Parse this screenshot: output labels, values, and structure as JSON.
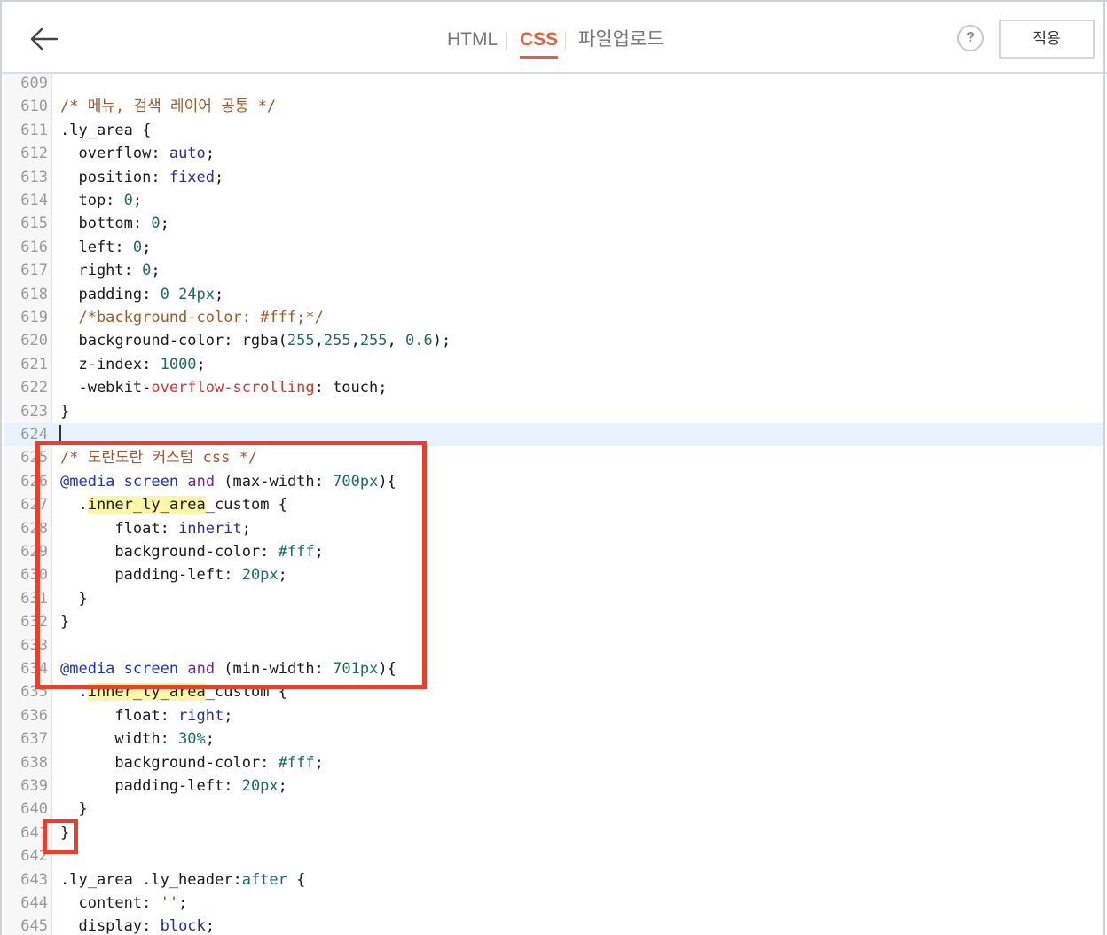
{
  "toolbar": {
    "tabs": [
      {
        "label": "HTML",
        "active": false
      },
      {
        "label": "CSS",
        "active": true
      },
      {
        "label": "파일업로드",
        "active": false
      }
    ],
    "help_label": "?",
    "apply_label": "적용"
  },
  "accent_color": "#ef5a33",
  "annotation_color": "#e8402a",
  "editor": {
    "current_line": 624,
    "lines": [
      {
        "n": "609",
        "tokens": []
      },
      {
        "n": "610",
        "tokens": [
          [
            "cm",
            "/* 메뉴, 검색 레이어 공통 */"
          ]
        ]
      },
      {
        "n": "611",
        "tokens": [
          [
            "pr",
            ".ly_area {"
          ]
        ]
      },
      {
        "n": "612",
        "tokens": [
          [
            "pr",
            "  overflow: "
          ],
          [
            "val",
            "auto"
          ],
          [
            "pr",
            ";"
          ]
        ]
      },
      {
        "n": "613",
        "tokens": [
          [
            "pr",
            "  position: "
          ],
          [
            "val",
            "fixed"
          ],
          [
            "pr",
            ";"
          ]
        ]
      },
      {
        "n": "614",
        "tokens": [
          [
            "pr",
            "  top: "
          ],
          [
            "nm",
            "0"
          ],
          [
            "pr",
            ";"
          ]
        ]
      },
      {
        "n": "615",
        "tokens": [
          [
            "pr",
            "  bottom: "
          ],
          [
            "nm",
            "0"
          ],
          [
            "pr",
            ";"
          ]
        ]
      },
      {
        "n": "616",
        "tokens": [
          [
            "pr",
            "  left: "
          ],
          [
            "nm",
            "0"
          ],
          [
            "pr",
            ";"
          ]
        ]
      },
      {
        "n": "617",
        "tokens": [
          [
            "pr",
            "  right: "
          ],
          [
            "nm",
            "0"
          ],
          [
            "pr",
            ";"
          ]
        ]
      },
      {
        "n": "618",
        "tokens": [
          [
            "pr",
            "  padding: "
          ],
          [
            "nm",
            "0 24px"
          ],
          [
            "pr",
            ";"
          ]
        ]
      },
      {
        "n": "619",
        "tokens": [
          [
            "cm",
            "  /*background-color: #fff;*/"
          ]
        ]
      },
      {
        "n": "620",
        "tokens": [
          [
            "pr",
            "  background-color: rgba("
          ],
          [
            "nm",
            "255"
          ],
          [
            "pr",
            ","
          ],
          [
            "nm",
            "255"
          ],
          [
            "pr",
            ","
          ],
          [
            "nm",
            "255"
          ],
          [
            "pr",
            ", "
          ],
          [
            "nm",
            "0.6"
          ],
          [
            "pr",
            ");"
          ]
        ]
      },
      {
        "n": "621",
        "tokens": [
          [
            "pr",
            "  z-index: "
          ],
          [
            "nm",
            "1000"
          ],
          [
            "pr",
            ";"
          ]
        ]
      },
      {
        "n": "622",
        "tokens": [
          [
            "pr",
            "  -webkit-"
          ],
          [
            "red",
            "overflow-scrolling"
          ],
          [
            "pr",
            ": touch;"
          ]
        ]
      },
      {
        "n": "623",
        "tokens": [
          [
            "pr",
            "}"
          ]
        ]
      },
      {
        "n": "624",
        "tokens": []
      },
      {
        "n": "625",
        "tokens": [
          [
            "cm",
            "/* 도란도란 커스텀 css */"
          ]
        ]
      },
      {
        "n": "626",
        "tokens": [
          [
            "at",
            "@media"
          ],
          [
            "pr",
            " "
          ],
          [
            "at",
            "screen"
          ],
          [
            "pr",
            " "
          ],
          [
            "kw",
            "and"
          ],
          [
            "pr",
            " (max-width: "
          ],
          [
            "nm",
            "700px"
          ],
          [
            "pr",
            "){"
          ]
        ]
      },
      {
        "n": "627",
        "tokens": [
          [
            "pr",
            "  ."
          ],
          [
            "hl",
            "inner_ly_area"
          ],
          [
            "pr",
            "_custom {"
          ]
        ]
      },
      {
        "n": "628",
        "tokens": [
          [
            "pr",
            "      float: "
          ],
          [
            "val",
            "inherit"
          ],
          [
            "pr",
            ";"
          ]
        ]
      },
      {
        "n": "629",
        "tokens": [
          [
            "pr",
            "      background-color: "
          ],
          [
            "nm",
            "#fff"
          ],
          [
            "pr",
            ";"
          ]
        ]
      },
      {
        "n": "630",
        "tokens": [
          [
            "pr",
            "      padding-left: "
          ],
          [
            "nm",
            "20px"
          ],
          [
            "pr",
            ";"
          ]
        ]
      },
      {
        "n": "631",
        "tokens": [
          [
            "pr",
            "  }"
          ]
        ]
      },
      {
        "n": "632",
        "tokens": [
          [
            "pr",
            "}"
          ]
        ]
      },
      {
        "n": "633",
        "tokens": []
      },
      {
        "n": "634",
        "tokens": [
          [
            "at",
            "@media"
          ],
          [
            "pr",
            " "
          ],
          [
            "at",
            "screen"
          ],
          [
            "pr",
            " "
          ],
          [
            "kw",
            "and"
          ],
          [
            "pr",
            " (min-width: "
          ],
          [
            "nm",
            "701px"
          ],
          [
            "pr",
            "){"
          ]
        ]
      },
      {
        "n": "635",
        "tokens": [
          [
            "pr",
            "  ."
          ],
          [
            "hl",
            "inner_ly_area"
          ],
          [
            "pr",
            "_custom {"
          ]
        ]
      },
      {
        "n": "636",
        "tokens": [
          [
            "pr",
            "      float: "
          ],
          [
            "val",
            "right"
          ],
          [
            "pr",
            ";"
          ]
        ]
      },
      {
        "n": "637",
        "tokens": [
          [
            "pr",
            "      width: "
          ],
          [
            "nm",
            "30%"
          ],
          [
            "pr",
            ";"
          ]
        ]
      },
      {
        "n": "638",
        "tokens": [
          [
            "pr",
            "      background-color: "
          ],
          [
            "nm",
            "#fff"
          ],
          [
            "pr",
            ";"
          ]
        ]
      },
      {
        "n": "639",
        "tokens": [
          [
            "pr",
            "      padding-left: "
          ],
          [
            "nm",
            "20px"
          ],
          [
            "pr",
            ";"
          ]
        ]
      },
      {
        "n": "640",
        "tokens": [
          [
            "pr",
            "  }"
          ]
        ]
      },
      {
        "n": "641",
        "tokens": [
          [
            "pr",
            "}"
          ]
        ]
      },
      {
        "n": "642",
        "tokens": []
      },
      {
        "n": "643",
        "tokens": [
          [
            "pr",
            ".ly_area .ly_header:"
          ],
          [
            "nm",
            "after"
          ],
          [
            "pr",
            " {"
          ]
        ]
      },
      {
        "n": "644",
        "tokens": [
          [
            "pr",
            "  content: "
          ],
          [
            "str",
            "''"
          ],
          [
            "pr",
            ";"
          ]
        ]
      },
      {
        "n": "645",
        "tokens": [
          [
            "pr",
            "  display: "
          ],
          [
            "val",
            "block"
          ],
          [
            "pr",
            ";"
          ]
        ]
      }
    ]
  }
}
